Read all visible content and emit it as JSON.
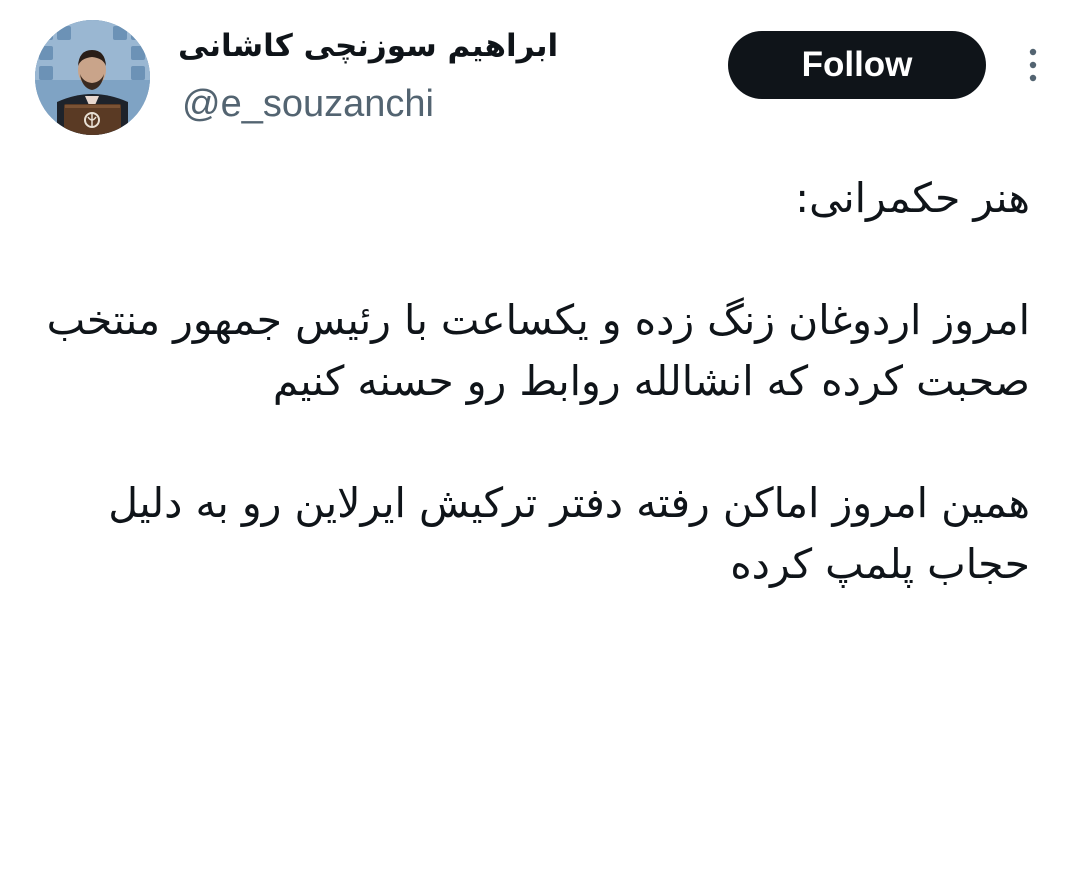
{
  "profile": {
    "display_name": "ابراهیم سوزنچی کاشانی",
    "handle": "@e_souzanchi",
    "avatar_icon": "person-at-podium-avatar"
  },
  "actions": {
    "follow_label": "Follow",
    "more_icon": "vertical-ellipsis-icon"
  },
  "tweet": {
    "paragraphs": [
      "هنر حکمرانی:",
      "امروز اردوغان زنگ زده و یکساعت با رئیس جمهور منتخب صحبت کرده که انشالله روابط رو حسنه کنیم",
      "همین امروز اماکن رفته دفتر ترکیش ایرلاین رو به دلیل حجاب پلمپ کرده"
    ]
  },
  "colors": {
    "text_primary": "#0f1419",
    "text_secondary": "#536471",
    "follow_bg": "#0f1419",
    "follow_text": "#ffffff",
    "background": "#ffffff"
  }
}
